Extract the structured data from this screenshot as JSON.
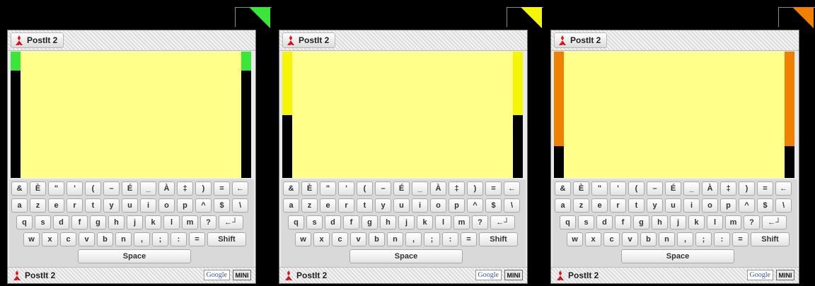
{
  "app_title": "PostIt 2",
  "panels": [
    {
      "accent": "#39e639",
      "indicator_fill": 0.15
    },
    {
      "accent": "#f5f507",
      "indicator_fill": 0.5
    },
    {
      "accent": "#f08000",
      "indicator_fill": 0.75
    }
  ],
  "keyboard": {
    "rows": [
      [
        "&",
        "È",
        "\"",
        "'",
        "(",
        "–",
        "É",
        "_",
        "À",
        "‡",
        ")",
        "=",
        "←"
      ],
      [
        "a",
        "z",
        "e",
        "r",
        "t",
        "y",
        "u",
        "i",
        "o",
        "p",
        "^",
        "$",
        "\\"
      ],
      [
        "q",
        "s",
        "d",
        "f",
        "g",
        "h",
        "j",
        "k",
        "l",
        "m",
        "?",
        "←┘"
      ],
      [
        "w",
        "x",
        "c",
        "v",
        "b",
        "n",
        ",",
        ";",
        ":",
        "=",
        "Shift"
      ],
      [
        "Space"
      ]
    ]
  },
  "bottom_bar": {
    "title": "PostIt 2",
    "google_label": "Google",
    "mini_label": "MINI"
  },
  "icons": {
    "logo": "red-tri-diamond-logo-icon"
  }
}
